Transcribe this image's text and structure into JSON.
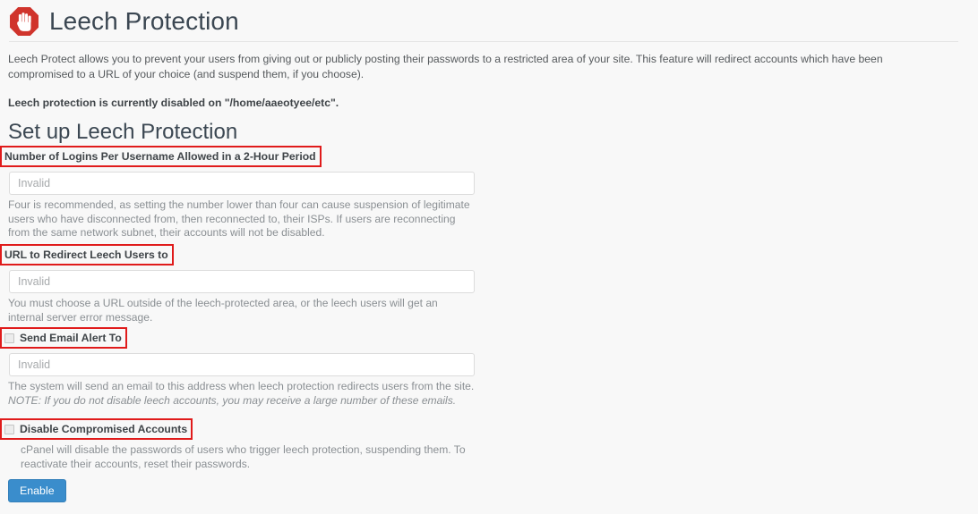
{
  "header": {
    "title": "Leech Protection",
    "icon": "stop-hand-icon"
  },
  "intro": {
    "paragraph": "Leech Protect allows you to prevent your users from giving out or publicly posting their passwords to a restricted area of your site. This feature will redirect accounts which have been compromised to a URL of your choice (and suspend them, if you choose).",
    "status": "Leech protection is currently disabled on \"/home/aaeotyee/etc\"."
  },
  "section": {
    "title": "Set up Leech Protection"
  },
  "fields": {
    "logins": {
      "label": "Number of Logins Per Username Allowed in a 2-Hour Period",
      "value": "",
      "placeholder": "Invalid",
      "help": "Four is recommended, as setting the number lower than four can cause suspension of legitimate users who have disconnected from, then reconnected to, their ISPs. If users are reconnecting from the same network subnet, their accounts will not be disabled."
    },
    "redirect_url": {
      "label": "URL to Redirect Leech Users to",
      "value": "",
      "placeholder": "Invalid",
      "help": "You must choose a URL outside of the leech-protected area, or the leech users will get an internal server error message."
    },
    "email_alert": {
      "label": "Send Email Alert To",
      "checked": false,
      "value": "",
      "placeholder": "Invalid",
      "help_main": "The system will send an email to this address when leech protection redirects users from the site. ",
      "help_note": "NOTE: If you do not disable leech accounts, you may receive a large number of these emails."
    },
    "disable_accounts": {
      "label": "Disable Compromised Accounts",
      "checked": false,
      "help": "cPanel will disable the passwords of users who trigger leech protection, suspending them. To reactivate their accounts, reset their passwords."
    }
  },
  "actions": {
    "enable_label": "Enable"
  },
  "colors": {
    "accent_blue": "#3a8dcc",
    "highlight_red": "#e01b1b",
    "icon_red": "#d0342c",
    "background": "#f8f8f8"
  }
}
